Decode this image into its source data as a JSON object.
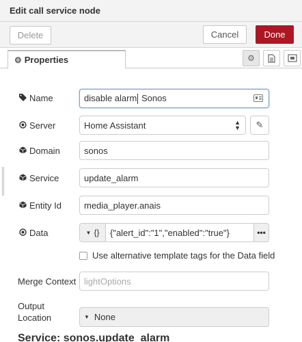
{
  "tray": {
    "title": "Edit call service node"
  },
  "toolbar": {
    "delete_label": "Delete",
    "cancel_label": "Cancel",
    "done_label": "Done"
  },
  "tabs": [
    {
      "label": "Properties"
    }
  ],
  "form": {
    "name": {
      "label": "Name",
      "value_before_cursor": "disable alarm",
      "value_after_cursor": " Sonos"
    },
    "server": {
      "label": "Server",
      "value": "Home Assistant"
    },
    "domain": {
      "label": "Domain",
      "value": "sonos"
    },
    "service": {
      "label": "Service",
      "value": "update_alarm"
    },
    "entity_id": {
      "label": "Entity Id",
      "value": "media_player.anais"
    },
    "data": {
      "label": "Data",
      "type": "{}",
      "value": "{\"alert_id\":\"1\",\"enabled\":\"true\"}",
      "more": "•••"
    },
    "alt_template": {
      "label": "Use alternative template tags for the Data field",
      "checked": false
    },
    "merge_context": {
      "label": "Merge Context",
      "placeholder": "lightOptions"
    },
    "output_location": {
      "label_line1": "Output",
      "label_line2": "Location",
      "value": "None"
    }
  },
  "section": {
    "title": "Service: sonos.update_alarm"
  },
  "colors": {
    "done_button": "#ad1625",
    "focus_border": "#79a5d6"
  }
}
